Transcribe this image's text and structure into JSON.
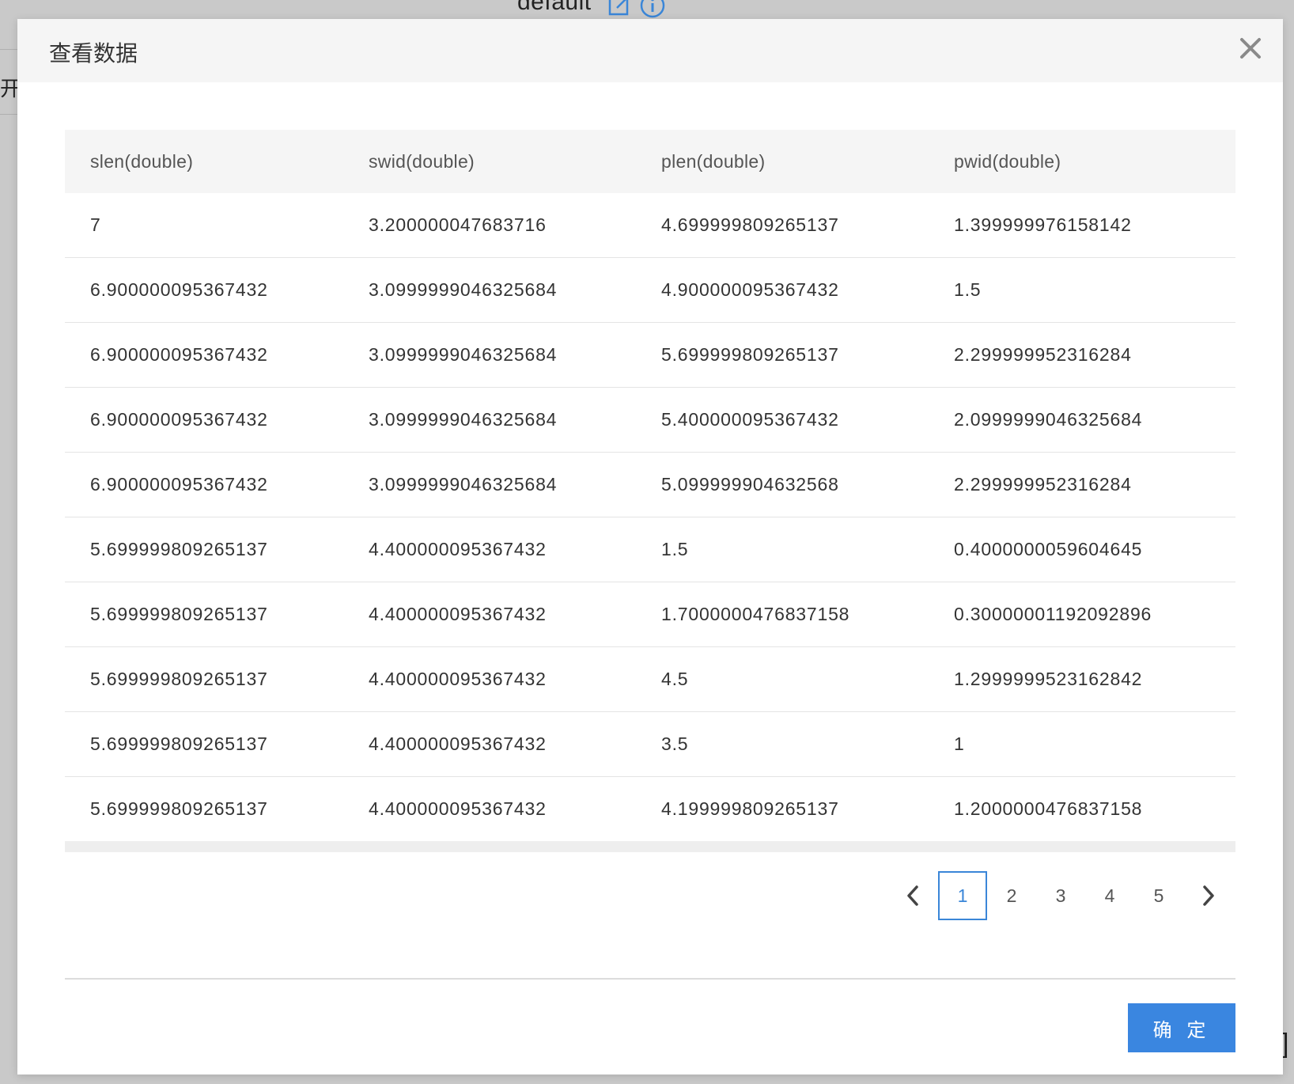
{
  "background": {
    "header_text": "default",
    "left_text": "开发"
  },
  "modal": {
    "title": "查看数据",
    "close_icon": "close-icon",
    "confirm_label": "确 定"
  },
  "table": {
    "columns": [
      "slen(double)",
      "swid(double)",
      "plen(double)",
      "pwid(double)"
    ],
    "rows": [
      [
        "7",
        "3.200000047683716",
        "4.699999809265137",
        "1.399999976158142"
      ],
      [
        "6.900000095367432",
        "3.0999999046325684",
        "4.900000095367432",
        "1.5"
      ],
      [
        "6.900000095367432",
        "3.0999999046325684",
        "5.699999809265137",
        "2.299999952316284"
      ],
      [
        "6.900000095367432",
        "3.0999999046325684",
        "5.400000095367432",
        "2.0999999046325684"
      ],
      [
        "6.900000095367432",
        "3.0999999046325684",
        "5.099999904632568",
        "2.299999952316284"
      ],
      [
        "5.699999809265137",
        "4.400000095367432",
        "1.5",
        "0.4000000059604645"
      ],
      [
        "5.699999809265137",
        "4.400000095367432",
        "1.7000000476837158",
        "0.30000001192092896"
      ],
      [
        "5.699999809265137",
        "4.400000095367432",
        "4.5",
        "1.2999999523162842"
      ],
      [
        "5.699999809265137",
        "4.400000095367432",
        "3.5",
        "1"
      ],
      [
        "5.699999809265137",
        "4.400000095367432",
        "4.199999809265137",
        "1.2000000476837158"
      ]
    ]
  },
  "pagination": {
    "pages": [
      "1",
      "2",
      "3",
      "4",
      "5"
    ],
    "current": "1",
    "accent_color": "#3a86d8"
  },
  "colors": {
    "primary": "#3a86e0",
    "header_bg": "#f5f5f5"
  }
}
